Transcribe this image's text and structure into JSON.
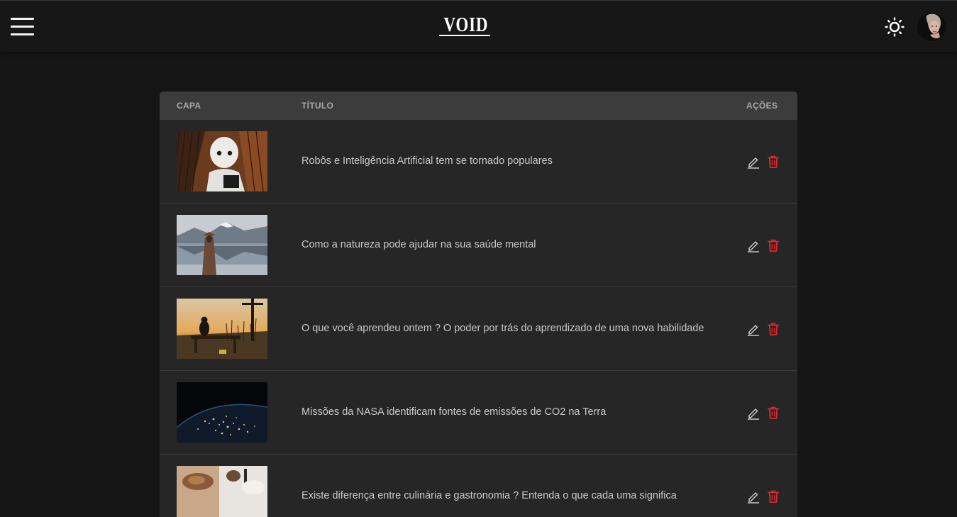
{
  "header": {
    "logo": "VOID",
    "menu_icon": "hamburger-menu-icon",
    "theme_icon": "sun-icon",
    "avatar_icon": "user-avatar"
  },
  "table": {
    "columns": {
      "cover": "CAPA",
      "title": "TÍTULO",
      "actions": "AÇÕES"
    },
    "rows": [
      {
        "title": "Robôs e Inteligência Artificial tem se tornado populares",
        "thumb": "robot-photo"
      },
      {
        "title": "Como a natureza pode ajudar na sua saúde mental",
        "thumb": "lake-mountain-photo"
      },
      {
        "title": "O que você aprendeu ontem ? O poder por trás do aprendizado de uma nova habilidade",
        "thumb": "sunset-bench-photo"
      },
      {
        "title": "Missões da NASA identificam fontes de emissões de CO2 na Terra",
        "thumb": "earth-night-photo"
      },
      {
        "title": "Existe diferença entre culinária e gastronomia ? Entenda o que cada uma significa",
        "thumb": "food-photo"
      }
    ],
    "action_icons": {
      "edit": "pencil-icon",
      "delete": "trash-icon"
    }
  },
  "colors": {
    "background": "#151515",
    "topbar": "#171717",
    "table_body": "#262626",
    "table_header": "#3c3c3c",
    "delete_red": "#e0282e",
    "edit_gray": "#c8c8c8"
  }
}
